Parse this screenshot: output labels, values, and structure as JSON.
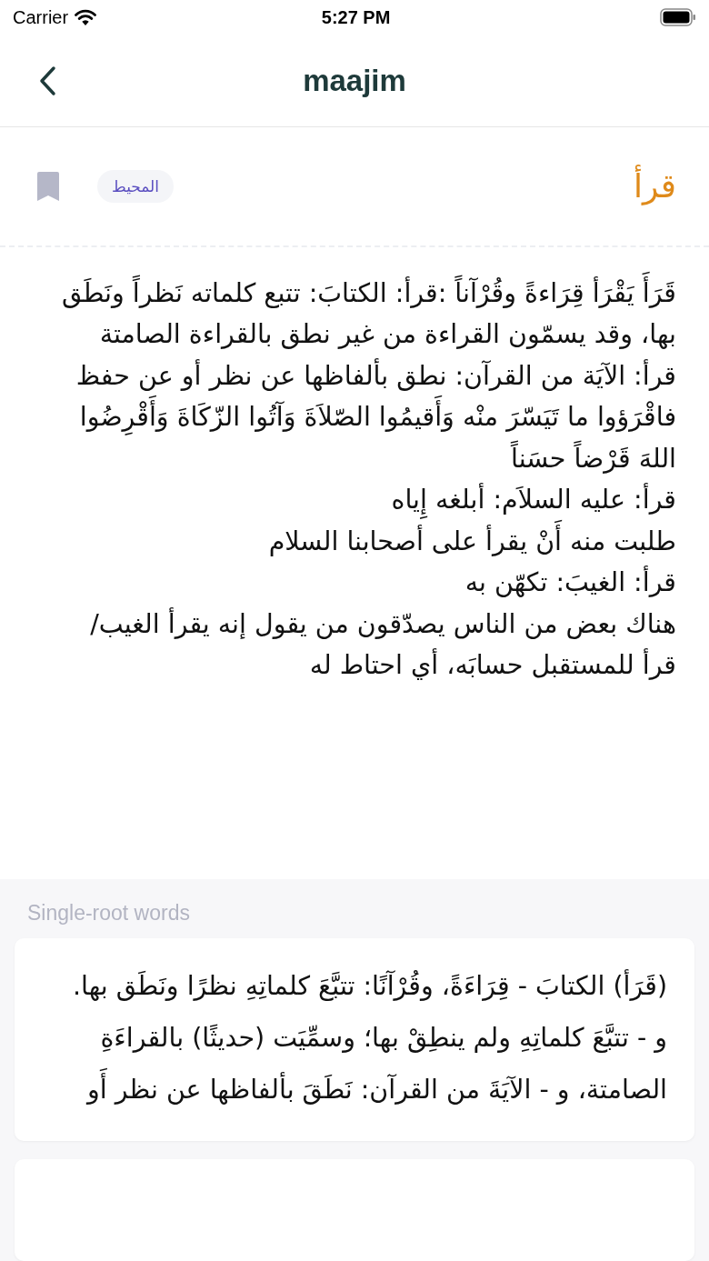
{
  "status_bar": {
    "carrier": "Carrier",
    "time": "5:27 PM"
  },
  "nav": {
    "title": "maajim"
  },
  "entry": {
    "word": "قرأ",
    "source": "المحيط",
    "lines": [
      "قَرَأَ يَقْرَأ قِرَاءةً وقُرْآناً :قرأ: الكتابَ: تتبع كلماته نَظراً ونَطَق",
      "بها، وقد يسمّون القراءة من غير نطق بالقراءة الصامتة",
      "قرأ: الآيَة من القرآن: نطق بألفاظها عن نظر أو عن حفظ",
      "فاقْرَؤوا ما تَيَسّرَ منْه وَأَقيمُوا الصّلاَةَ وَآتُوا الزّكَاةَ وَأَقْرِضُوا",
      "اللهَ قَرْضاً حسَناً",
      "قرأ: عليه السلاَم: أبلغه إِياه",
      "طلبت منه أَنْ يقرأ على أصحابنا السلام",
      "قرأ: الغيبَ: تكهّن به",
      "هناك بعض من الناس يصدّقون من يقول إنه يقرأ الغيب/",
      "قرأ للمستقبل حسابَه، أي احتاط له"
    ]
  },
  "related": {
    "heading": "Single-root words",
    "cards": [
      {
        "lines": [
          "(قَرَأ) الكتابَ - قِرَاءَةً، وقُرْآنًا: تتبَّعَ كلماتِهِ نظرًا ونَطَق بها.",
          "و - تتبَّعَ كلماتِهِ ولم ينطِقْ بها؛ وسمِّيَت (حديثًا) بالقراءَةِ",
          "الصامتة، و - الآيَةَ من القرآن: نَطَقَ بألفاظها عن نظر أَو"
        ]
      },
      {
        "kind": "clipped"
      }
    ]
  }
}
